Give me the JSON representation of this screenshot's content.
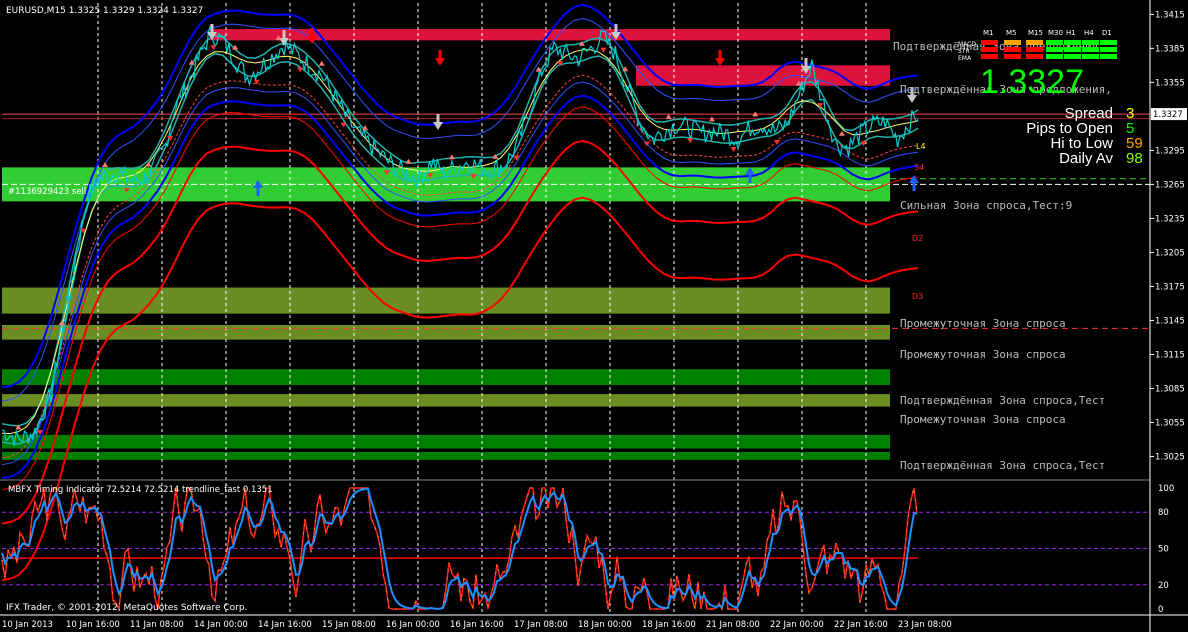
{
  "colors": {
    "background": "#000000",
    "grid": "#ffffff",
    "price_line": "#ff4040",
    "supply_zone": "#dc143c",
    "demand_zone_strong": "#32cd32",
    "demand_zone_mid": "#6b8e23",
    "demand_zone_confirmed": "#008000",
    "band_outer": "#0000ff",
    "band_red": "#ff0000",
    "ma_cyan": "#20b2aa",
    "ma_yellow": "#ffff66",
    "price_bar": "#00ced1",
    "rsi_blue": "#1e90ff",
    "rsi_red": "#ff2020",
    "rsi_orange": "#ffa500",
    "big_price": "#00ff00",
    "spread_val": "#ffff00",
    "pips_val": "#00ff00",
    "hilow_val": "#ffa500",
    "daily_val": "#7fff00"
  },
  "header": {
    "symbol_info": "EURUSD,M15  1.3325 1.3329 1.3324 1.3327"
  },
  "panel": {
    "timeframes": [
      "M1",
      "M5",
      "M15",
      "M30",
      "H1",
      "H4",
      "D1"
    ],
    "rows": [
      "MACD",
      "STR",
      "EMA"
    ],
    "row_colors": [
      [
        "#ff0000",
        "#ffa500",
        "#ffa500",
        "#00ff00",
        "#00ff00",
        "#00ff00",
        "#00ff00"
      ],
      [
        "#ff0000",
        "#ff0000",
        "#ff0000",
        "#00ff00",
        "#00ff00",
        "#00ff00",
        "#00ff00"
      ],
      [
        "#ff0000",
        "#ff0000",
        "#ff0000",
        "#00ff00",
        "#00ff00",
        "#00ff00",
        "#00ff00"
      ]
    ],
    "big_price": "1.3327",
    "stats": [
      {
        "label": "Spread",
        "value": "3"
      },
      {
        "label": "Pips to Open",
        "value": "5"
      },
      {
        "label": "Hi to Low",
        "value": "59"
      },
      {
        "label": "Daily Av",
        "value": "98"
      }
    ]
  },
  "zone_labels": {
    "supply1": "Подтверждённая Зона предложения,",
    "supply2": "Подтверждённая Зона предложения,",
    "demand1": "Сильная Зона спроса,Тест:9",
    "demand2": "Промежуточная Зона спроса",
    "demand3": "Промежуточная Зона спроса",
    "demand4": "Подтверждённая Зона спроса,Тест",
    "demand5": "Промежуточная Зона спроса",
    "demand6": "Подтверждённая Зона спроса,Тест"
  },
  "order_label": "#1136929423 sell",
  "level_labels": {
    "d2": "D2",
    "d3": "D3",
    "s4": "S4",
    "l4": "L4"
  },
  "current_price_tag": "1.3327",
  "indicator": {
    "title": "MBFX Timing Indicator 72.5214 72.5214  trendline_fast 0.1351",
    "ticks": [
      "100",
      "80",
      "50",
      "20",
      "0"
    ]
  },
  "copyright": "IFX Trader, © 2001-2012, MetaQuotes Software Corp.",
  "chart_data": {
    "type": "line",
    "title": "EURUSD,M15  1.3325 1.3329 1.3324 1.3327",
    "y_axis_ticks": [
      "1.3415",
      "1.3385",
      "1.3355",
      "1.3325",
      "1.3295",
      "1.3265",
      "1.3235",
      "1.3205",
      "1.3175",
      "1.3145",
      "1.3115",
      "1.3085",
      "1.3055",
      "1.3025"
    ],
    "ylim": [
      1.3006,
      1.3425
    ],
    "x_axis_ticks": [
      "10 Jan 2013",
      "10 Jan 16:00",
      "11 Jan 08:00",
      "14 Jan 00:00",
      "14 Jan 16:00",
      "15 Jan 08:00",
      "16 Jan 00:00",
      "16 Jan 16:00",
      "17 Jan 08:00",
      "18 Jan 00:00",
      "18 Jan 16:00",
      "21 Jan 08:00",
      "22 Jan 00:00",
      "22 Jan 16:00",
      "23 Jan 08:00"
    ],
    "current_price": 1.3327,
    "price_series": [
      [
        0,
        1.3048
      ],
      [
        4,
        1.304
      ],
      [
        8,
        1.3046
      ],
      [
        12,
        1.308
      ],
      [
        15,
        1.314
      ],
      [
        18,
        1.32
      ],
      [
        21,
        1.3255
      ],
      [
        24,
        1.327
      ],
      [
        28,
        1.3275
      ],
      [
        32,
        1.3268
      ],
      [
        36,
        1.3272
      ],
      [
        40,
        1.33
      ],
      [
        42,
        1.333
      ],
      [
        45,
        1.335
      ],
      [
        48,
        1.3375
      ],
      [
        51,
        1.3398
      ],
      [
        54,
        1.3392
      ],
      [
        57,
        1.3375
      ],
      [
        60,
        1.336
      ],
      [
        63,
        1.3368
      ],
      [
        66,
        1.3378
      ],
      [
        69,
        1.3388
      ],
      [
        72,
        1.338
      ],
      [
        75,
        1.337
      ],
      [
        78,
        1.3362
      ],
      [
        81,
        1.3345
      ],
      [
        84,
        1.3325
      ],
      [
        87,
        1.331
      ],
      [
        90,
        1.33
      ],
      [
        93,
        1.329
      ],
      [
        96,
        1.328
      ],
      [
        99,
        1.3275
      ],
      [
        102,
        1.327
      ],
      [
        105,
        1.3285
      ],
      [
        108,
        1.3275
      ],
      [
        111,
        1.328
      ],
      [
        114,
        1.3285
      ],
      [
        117,
        1.328
      ],
      [
        120,
        1.3278
      ],
      [
        123,
        1.3282
      ],
      [
        126,
        1.33
      ],
      [
        129,
        1.333
      ],
      [
        132,
        1.3365
      ],
      [
        135,
        1.3385
      ],
      [
        138,
        1.338
      ],
      [
        141,
        1.3376
      ],
      [
        144,
        1.3385
      ],
      [
        147,
        1.3395
      ],
      [
        150,
        1.338
      ],
      [
        153,
        1.335
      ],
      [
        156,
        1.332
      ],
      [
        159,
        1.3305
      ],
      [
        162,
        1.3312
      ],
      [
        165,
        1.3318
      ],
      [
        168,
        1.3315
      ],
      [
        171,
        1.331
      ],
      [
        174,
        1.3312
      ],
      [
        177,
        1.331
      ],
      [
        180,
        1.3305
      ],
      [
        183,
        1.3315
      ],
      [
        186,
        1.3318
      ],
      [
        189,
        1.3312
      ],
      [
        192,
        1.3318
      ],
      [
        195,
        1.3345
      ],
      [
        198,
        1.337
      ],
      [
        201,
        1.3335
      ],
      [
        204,
        1.33
      ],
      [
        207,
        1.3298
      ],
      [
        210,
        1.331
      ],
      [
        213,
        1.3318
      ],
      [
        216,
        1.332
      ],
      [
        219,
        1.3305
      ],
      [
        222,
        1.332
      ],
      [
        224,
        1.3327
      ]
    ],
    "series": [
      {
        "name": "MBFX Timing Indicator",
        "values_range": [
          0,
          100
        ]
      },
      {
        "name": "trendline_fast",
        "last_value": 0.1351
      }
    ]
  }
}
